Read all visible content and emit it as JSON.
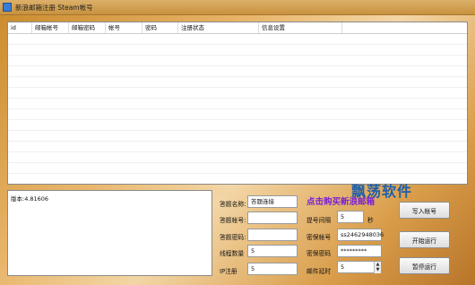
{
  "window": {
    "title": "新浪邮箱注册 Steam帐号"
  },
  "table": {
    "columns": [
      "id",
      "邮箱帐号",
      "邮箱密码",
      "帐号",
      "密码",
      "注册状态",
      "信息设置"
    ],
    "rows": []
  },
  "log": {
    "text": "版本:4.81606"
  },
  "form": {
    "dama_name_label": "答题名称:",
    "dama_name_value": "答题连接",
    "dama_account_label": "答题帐号:",
    "dama_account_value": "",
    "dama_password_label": "答题密码:",
    "dama_password_value": "",
    "threads_label": "线程数量",
    "threads_value": "5",
    "ip_label": "IP注册",
    "ip_value": "5",
    "interval_label": "提号间隔",
    "interval_value": "5",
    "interval_unit": "秒",
    "qq_account_label": "密保帐号",
    "qq_account_value": "ss2462948036",
    "qq_password_label": "密保密码",
    "qq_password_value": "*********",
    "mail_interval_label": "邮件延时",
    "mail_interval_value": "5"
  },
  "buttons": {
    "import": "写入帐号",
    "start": "开始运行",
    "stop": "暂停运行"
  },
  "watermark": "飘荡软件",
  "promo": "点击购买新浪邮箱"
}
